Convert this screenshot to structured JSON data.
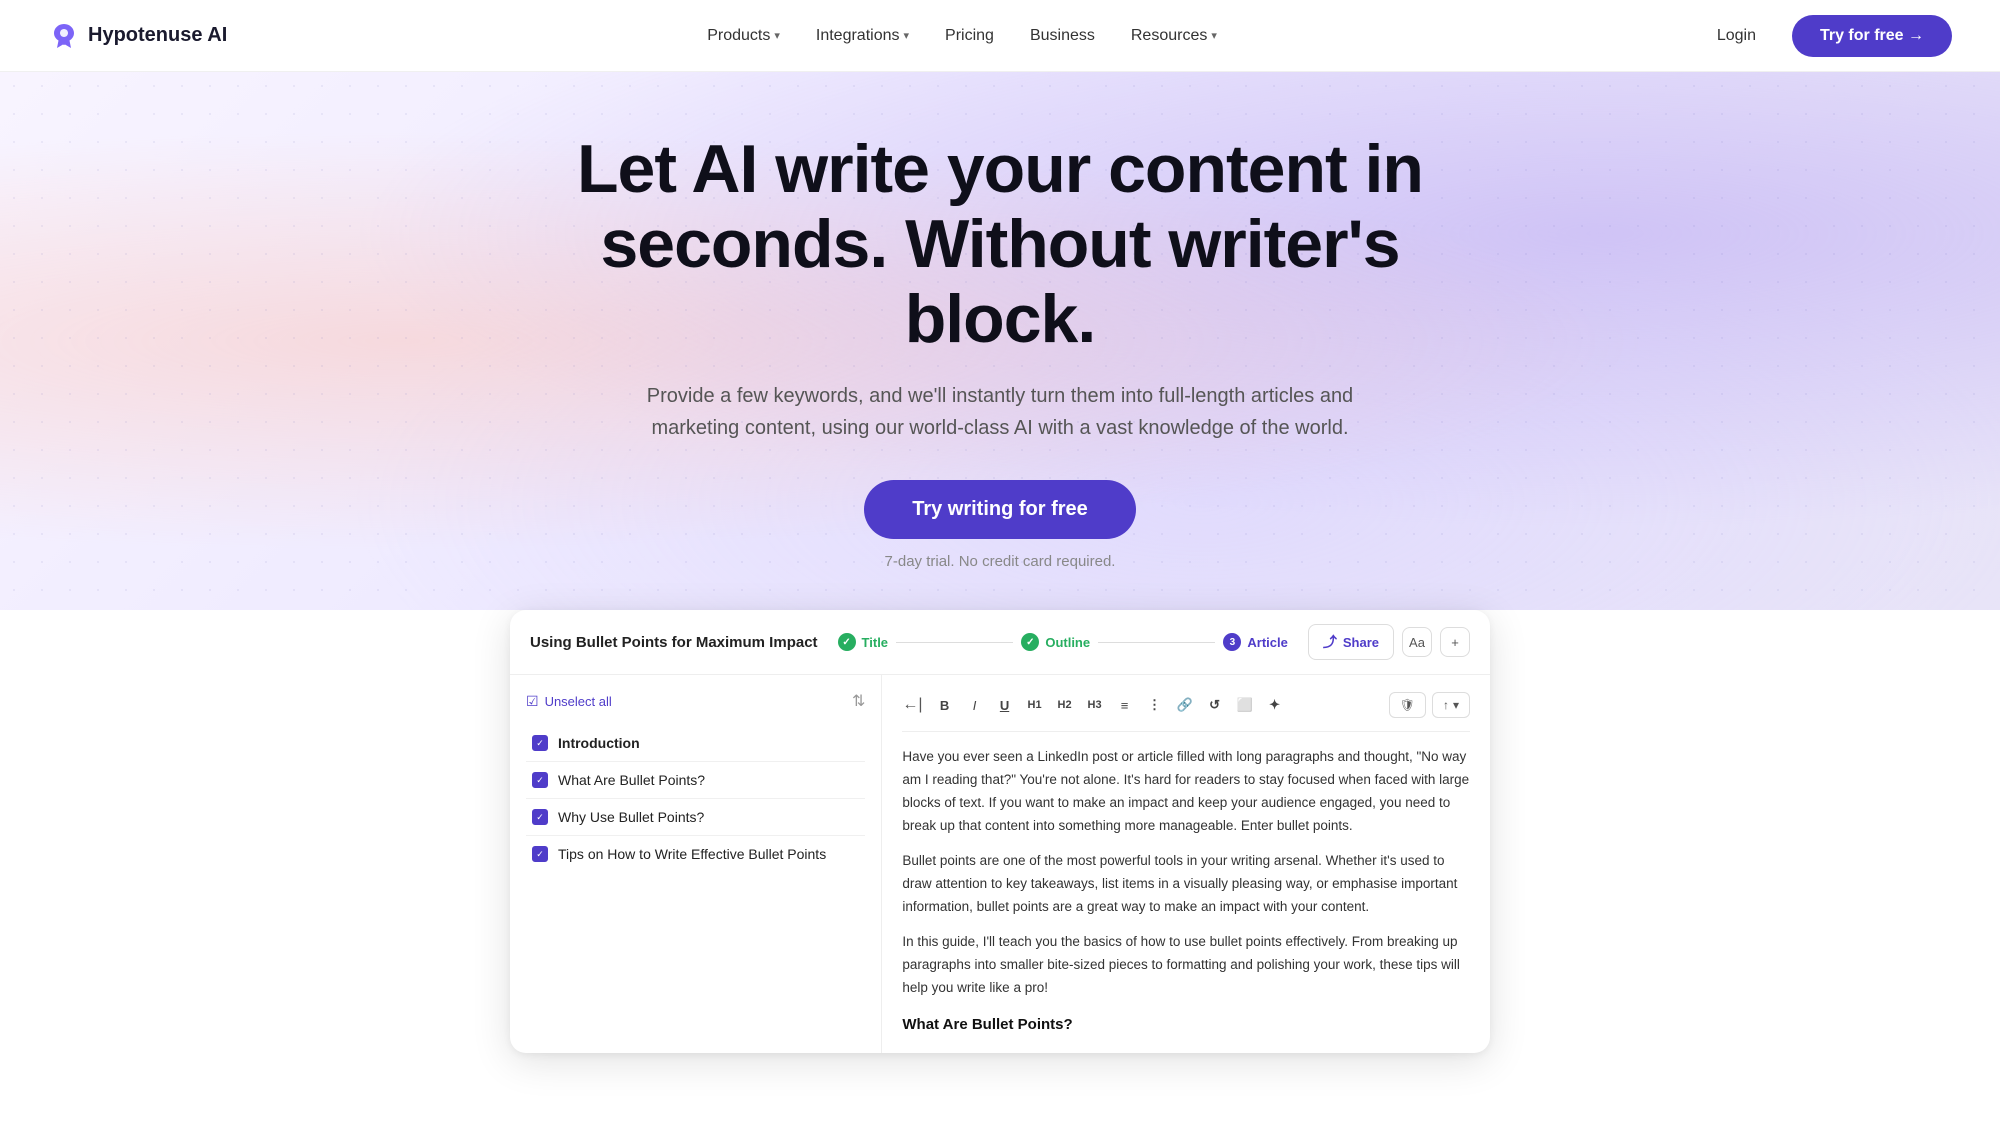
{
  "nav": {
    "logo_text": "Hypotenuse AI",
    "links": [
      {
        "label": "Products",
        "has_dropdown": true
      },
      {
        "label": "Integrations",
        "has_dropdown": true
      },
      {
        "label": "Pricing",
        "has_dropdown": false
      },
      {
        "label": "Business",
        "has_dropdown": false
      },
      {
        "label": "Resources",
        "has_dropdown": true
      }
    ],
    "login_label": "Login",
    "try_label": "Try for free →"
  },
  "hero": {
    "title": "Let AI write your content in seconds. Without writer's block.",
    "subtitle": "Provide a few keywords, and we'll instantly turn them into full-length articles and marketing content, using our world-class AI with a vast knowledge of the world.",
    "cta_label": "Try writing for free",
    "note": "7-day trial. No credit card required."
  },
  "demo": {
    "doc_title": "Using Bullet Points for Maximum Impact",
    "steps": [
      {
        "label": "Title",
        "state": "done"
      },
      {
        "label": "Outline",
        "state": "done"
      },
      {
        "label": "Article",
        "state": "active",
        "number": "3"
      }
    ],
    "share_label": "Share",
    "toolbar_buttons": [
      "B",
      "I",
      "U",
      "H1",
      "H2",
      "H3",
      "≡",
      "⋮",
      "🔗",
      "↺",
      "🖼",
      "⬡"
    ],
    "outline_items": [
      {
        "label": "Unselect all",
        "is_header": true
      },
      {
        "label": "Introduction",
        "bold": true
      },
      {
        "label": "What Are Bullet Points?",
        "bold": false
      },
      {
        "label": "Why Use Bullet Points?",
        "bold": false
      },
      {
        "label": "Tips on How to Write Effective Bullet Points",
        "bold": false
      }
    ],
    "article": {
      "paragraphs": [
        "Have you ever seen a LinkedIn post or article filled with long paragraphs and thought, \"No way am I reading that?\" You're not alone. It's hard for readers to stay focused when faced with large blocks of text. If you want to make an impact and keep your audience engaged, you need to break up that content into something more manageable. Enter bullet points.",
        "Bullet points are one of the most powerful tools in your writing arsenal. Whether it's used to draw attention to key takeaways, list items in a visually pleasing way, or emphasise important information, bullet points are a great way to make an impact with your content.",
        "In this guide, I'll teach you the basics of how to use bullet points effectively. From breaking up paragraphs into smaller bite-sized pieces to formatting and polishing your work, these tips will help you write like a pro!"
      ],
      "subheading": "What Are Bullet Points?"
    }
  }
}
